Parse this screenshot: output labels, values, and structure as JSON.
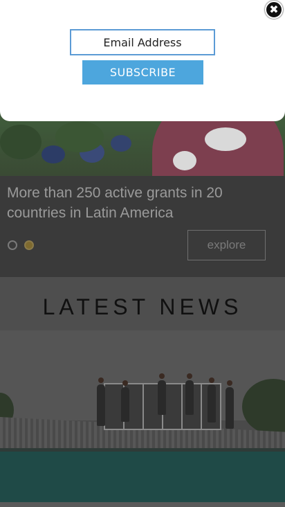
{
  "popup": {
    "email_placeholder": "Email Address",
    "subscribe_label": "SUBSCRIBE",
    "close_icon": "close-icon",
    "close_glyph": "✖"
  },
  "hero": {
    "caption": "More than 250 active grants in 20 countries in Latin America",
    "explore_label": "explore",
    "slides": 2,
    "active_slide": 2,
    "dot_active_color": "#7e6a2f"
  },
  "news": {
    "section_title": "LATEST NEWS"
  },
  "colors": {
    "accent": "#4da6dd",
    "input_border": "#5b9bd5"
  }
}
